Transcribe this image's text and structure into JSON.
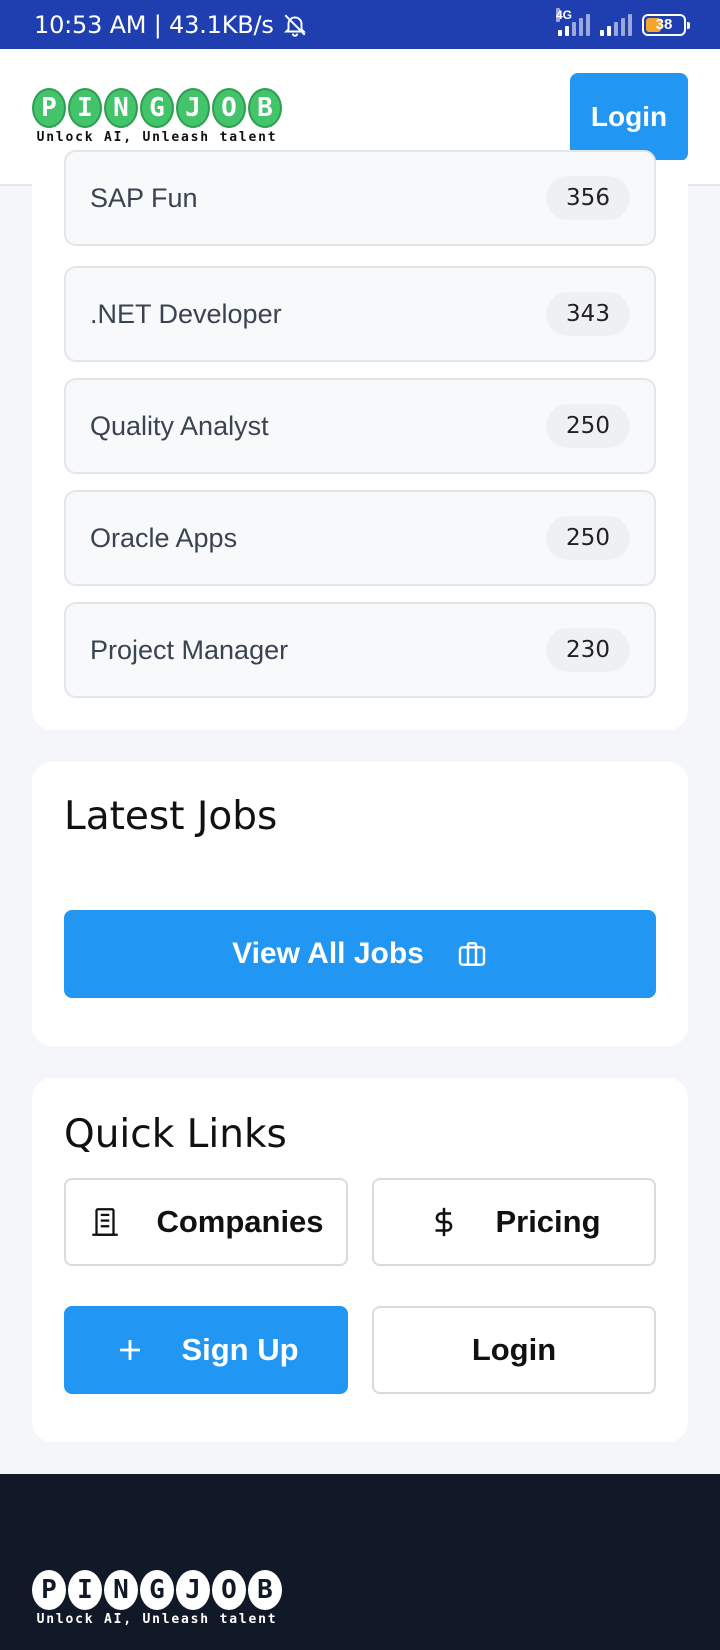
{
  "status_bar": {
    "time": "10:53 AM | 43.1KB/s",
    "network": "4G",
    "battery": "38"
  },
  "header": {
    "logo_letters": [
      "P",
      "I",
      "N",
      "G",
      "J",
      "O",
      "B"
    ],
    "tagline": "Unlock AI, Unleash talent",
    "login_label": "Login"
  },
  "categories": [
    {
      "name": "SAP Fun",
      "count": "356"
    },
    {
      "name": ".NET Developer",
      "count": "343"
    },
    {
      "name": "Quality Analyst",
      "count": "250"
    },
    {
      "name": "Oracle Apps",
      "count": "250"
    },
    {
      "name": "Project Manager",
      "count": "230"
    }
  ],
  "latest_jobs": {
    "title": "Latest Jobs",
    "view_all_label": "View All Jobs"
  },
  "quick_links": {
    "title": "Quick Links",
    "companies_label": "Companies",
    "pricing_label": "Pricing",
    "signup_label": "Sign Up",
    "login_label": "Login"
  },
  "footer": {
    "tagline": "Unlock AI, Unleash talent"
  },
  "colors": {
    "status_bar": "#1f3fb0",
    "primary": "#2196f3",
    "logo_green": "#43c46b",
    "footer_bg": "#111827"
  }
}
